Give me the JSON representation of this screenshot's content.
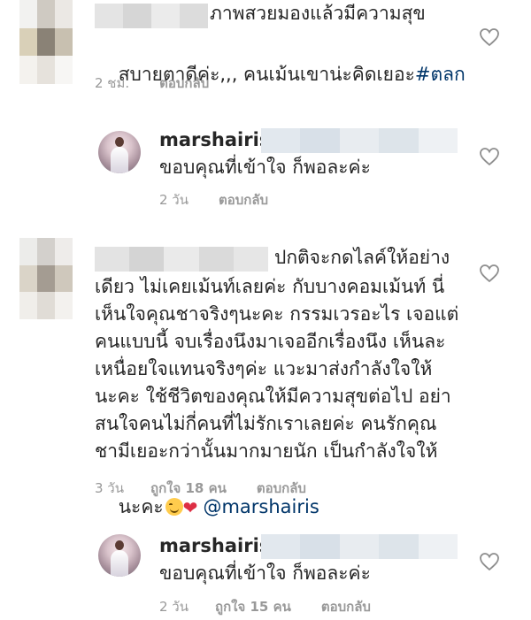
{
  "comments": [
    {
      "id": "c1",
      "lines": [
        "ภาพสวยมองแล้วมีความสุข",
        "สบายตาดีค่ะ,,, คนเม้นเขาน่ะคิดเยอะ"
      ],
      "hashtag": "#ตลก",
      "time": "2 ชม.",
      "reply_label": "ตอบกลับ"
    },
    {
      "id": "r1",
      "username": "marshairis",
      "text": "ขอบคุณที่เข้าใจ ก็พอละค่ะ",
      "time": "2 วัน",
      "reply_label": "ตอบกลับ"
    },
    {
      "id": "c2",
      "lines": [
        "ปกติจะกดไลค์ให้อย่าง",
        "เดียว ไม่เคยเม้นท์เลยค่ะ กับบางคอมเม้นท์ นี่",
        "เห็นใจคุณชาจริงๆนะคะ กรรมเวรอะไร เจอแต่",
        "คนแบบนี้ จบเรื่องนึงมาเจออีกเรื่องนึง เห็นละ",
        "เหนื่อยใจแทนจริงๆค่ะ แวะมาส่งกำลังใจให้",
        "นะคะ ใช้ชีวิตของคุณให้มีความสุขต่อไป อย่า",
        "สนใจคนไม่กี่คนที่ไม่รักเราเลยค่ะ คนรักคุณ",
        "ชามีเยอะกว่านั้นมากมายนัก เป็นกำลังใจให้",
        "นะคะ"
      ],
      "mention": "@marshairis",
      "time": "3 วัน",
      "likes": "ถูกใจ 18 คน",
      "reply_label": "ตอบกลับ"
    },
    {
      "id": "r2",
      "username": "marshairis",
      "text": "ขอบคุณที่เข้าใจ ก็พอละค่ะ",
      "time": "2 วัน",
      "likes": "ถูกใจ 15 คน",
      "reply_label": "ตอบกลับ"
    }
  ],
  "colors": {
    "text": "#262626",
    "meta": "#999999",
    "link": "#003569",
    "heart_stroke": "#8e8e8e"
  }
}
